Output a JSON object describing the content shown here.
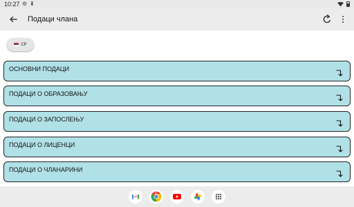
{
  "status_bar": {
    "time": "10:27",
    "icons": [
      "gear-icon",
      "download-icon",
      "wifi-icon",
      "battery-icon"
    ]
  },
  "app_bar": {
    "title": "Подаци члана",
    "icons": [
      "back-arrow-icon",
      "refresh-icon",
      "more-vert-icon"
    ]
  },
  "language_chip": {
    "label": "СР",
    "flag": "serbia-flag-icon",
    "flag_colors": [
      "#c6363c",
      "#0c4076",
      "#ffffff"
    ]
  },
  "sections": [
    {
      "label": "ОСНОВНИ ПОДАЦИ"
    },
    {
      "label": "ПОДАЦИ О ОБРАЗОВАЊУ"
    },
    {
      "label": "ПОДАЦИ О ЗАПОСЛЕЊУ"
    },
    {
      "label": "ПОДАЦИ О ЛИЦЕНЦИ"
    },
    {
      "label": "ПОДАЦИ О ЧЛАНАРИНИ"
    }
  ],
  "dock_apps": [
    "gmail-icon",
    "chrome-icon",
    "youtube-icon",
    "photos-icon",
    "app-drawer-icon"
  ],
  "colors": {
    "section_background": "#b0e1e7",
    "section_border": "#222222",
    "app_bar_background": "#ececec"
  }
}
